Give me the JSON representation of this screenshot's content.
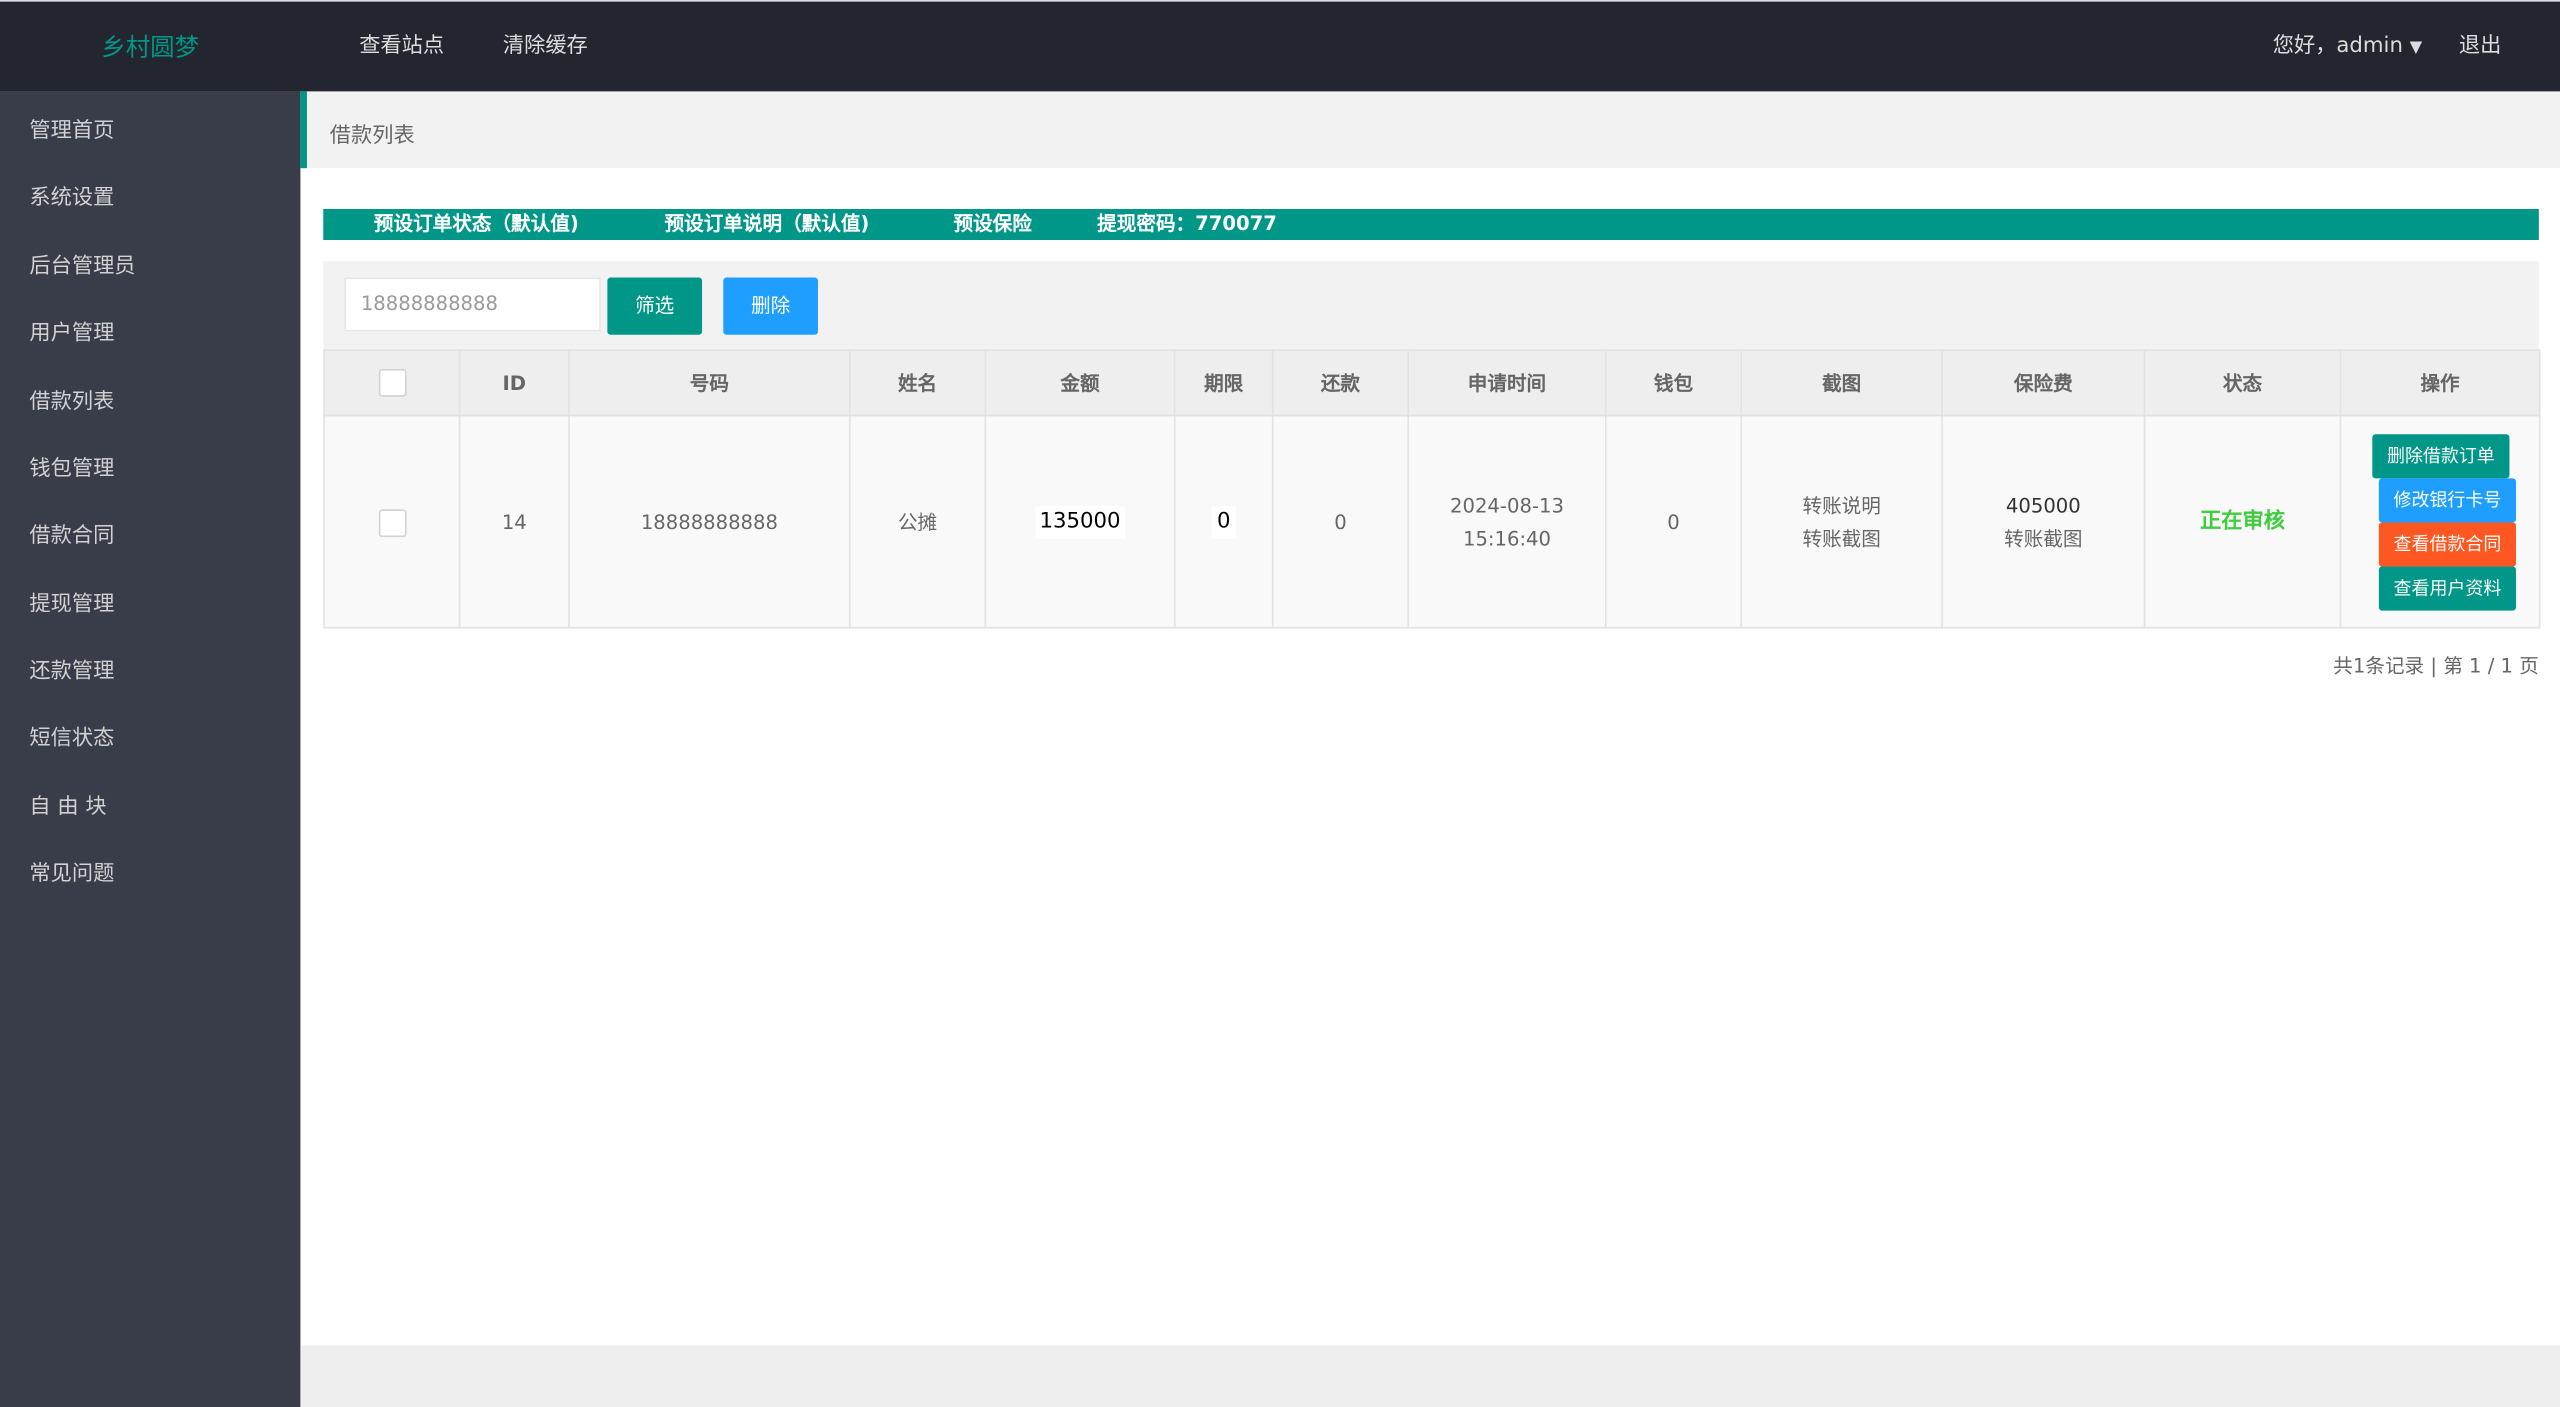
{
  "header": {
    "logo": "乡村圆梦",
    "nav": [
      "查看站点",
      "清除缓存"
    ],
    "greeting": "您好，admin",
    "logout": "退出"
  },
  "sidebar": {
    "items": [
      "管理首页",
      "系统设置",
      "后台管理员",
      "用户管理",
      "借款列表",
      "钱包管理",
      "借款合同",
      "提现管理",
      "还款管理",
      "短信状态",
      "自 由 块",
      "常见问题"
    ]
  },
  "breadcrumb": "借款列表",
  "toolbar": {
    "items": [
      "预设订单状态（默认值)",
      "预设订单说明（默认值)",
      "预设保险",
      "提现密码：770077"
    ]
  },
  "filter": {
    "search_value": "18888888888",
    "filter_label": "筛选",
    "delete_label": "删除"
  },
  "table": {
    "headers": [
      "ID",
      "号码",
      "姓名",
      "金额",
      "期限",
      "还款",
      "申请时间",
      "钱包",
      "截图",
      "保险费",
      "状态",
      "操作"
    ],
    "rows": [
      {
        "id": "14",
        "phone": "18888888888",
        "name": "公摊",
        "amount": "135000",
        "term": "0",
        "repay": "0",
        "date": "2024-08-13",
        "time": "15:16:40",
        "wallet": "0",
        "shot1": "转账说明",
        "shot2": "转账截图",
        "fee": "405000",
        "fee_shot": "转账截图",
        "status": "正在审核",
        "actions": [
          "删除借款订单",
          "修改银行卡号",
          "查看借款合同",
          "查看用户资料"
        ]
      }
    ]
  },
  "pagination": "共1条记录 | 第 1 / 1 页",
  "colors": {
    "teal": "#009688",
    "blue": "#1e9fff",
    "orange": "#ff5722",
    "status_green": "#3fcc3f"
  }
}
